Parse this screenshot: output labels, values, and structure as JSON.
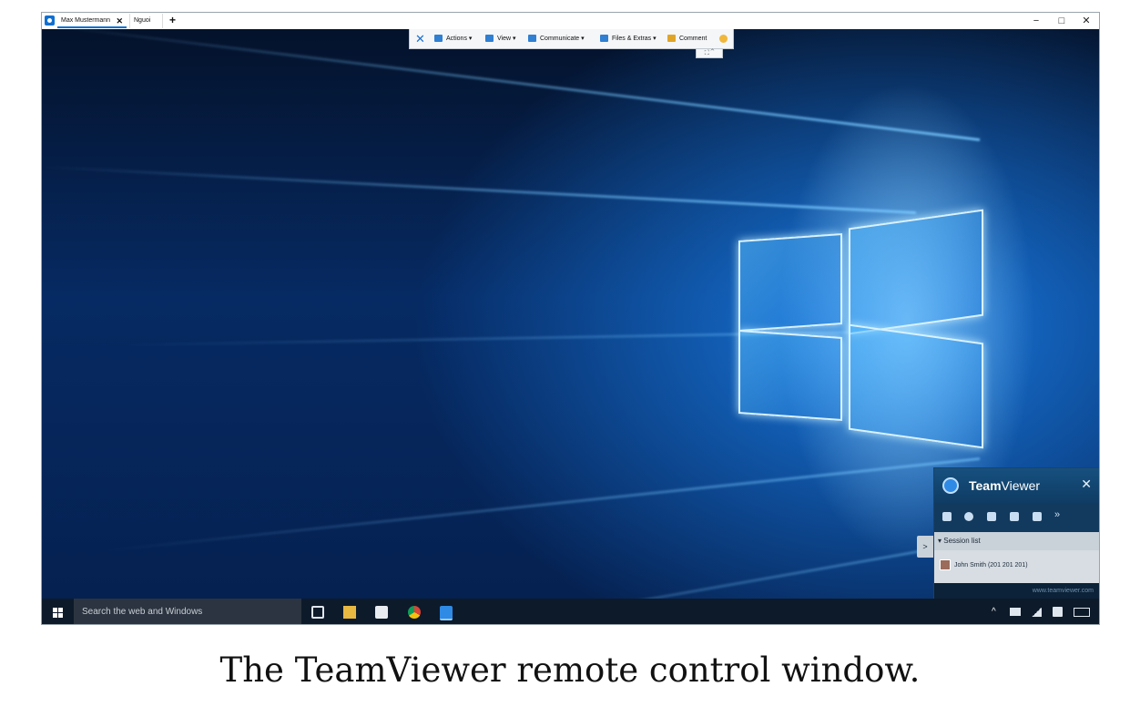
{
  "window": {
    "tabs": [
      {
        "label": "Max Mustermann",
        "close": "✕"
      },
      {
        "label": "Nguoi La"
      }
    ],
    "new_tab": "+",
    "controls": {
      "minimize": "−",
      "maximize": "□",
      "close": "✕"
    }
  },
  "toolbar": {
    "close": "✕",
    "items": [
      {
        "label": "Actions ▾",
        "icon": "actions-icon"
      },
      {
        "label": "View ▾",
        "icon": "monitor-icon"
      },
      {
        "label": "Communicate ▾",
        "icon": "phone-icon"
      },
      {
        "label": "Files & Extras ▾",
        "icon": "files-icon"
      },
      {
        "label": "Comment",
        "icon": "comment-icon"
      }
    ],
    "collapse_tab": "⛶ ⌃"
  },
  "taskbar": {
    "search_placeholder": "Search the web and Windows",
    "tray": {
      "chevron": "^"
    }
  },
  "teamviewer_panel": {
    "title_bold": "Team",
    "title_rest": "Viewer",
    "close": "✕",
    "more": "»",
    "session_list": "▾ Session list",
    "collapse": ">",
    "session_user": "John Smith (201 201 201)",
    "footer": "www.teamviewer.com"
  },
  "caption": "The TeamViewer remote control window."
}
